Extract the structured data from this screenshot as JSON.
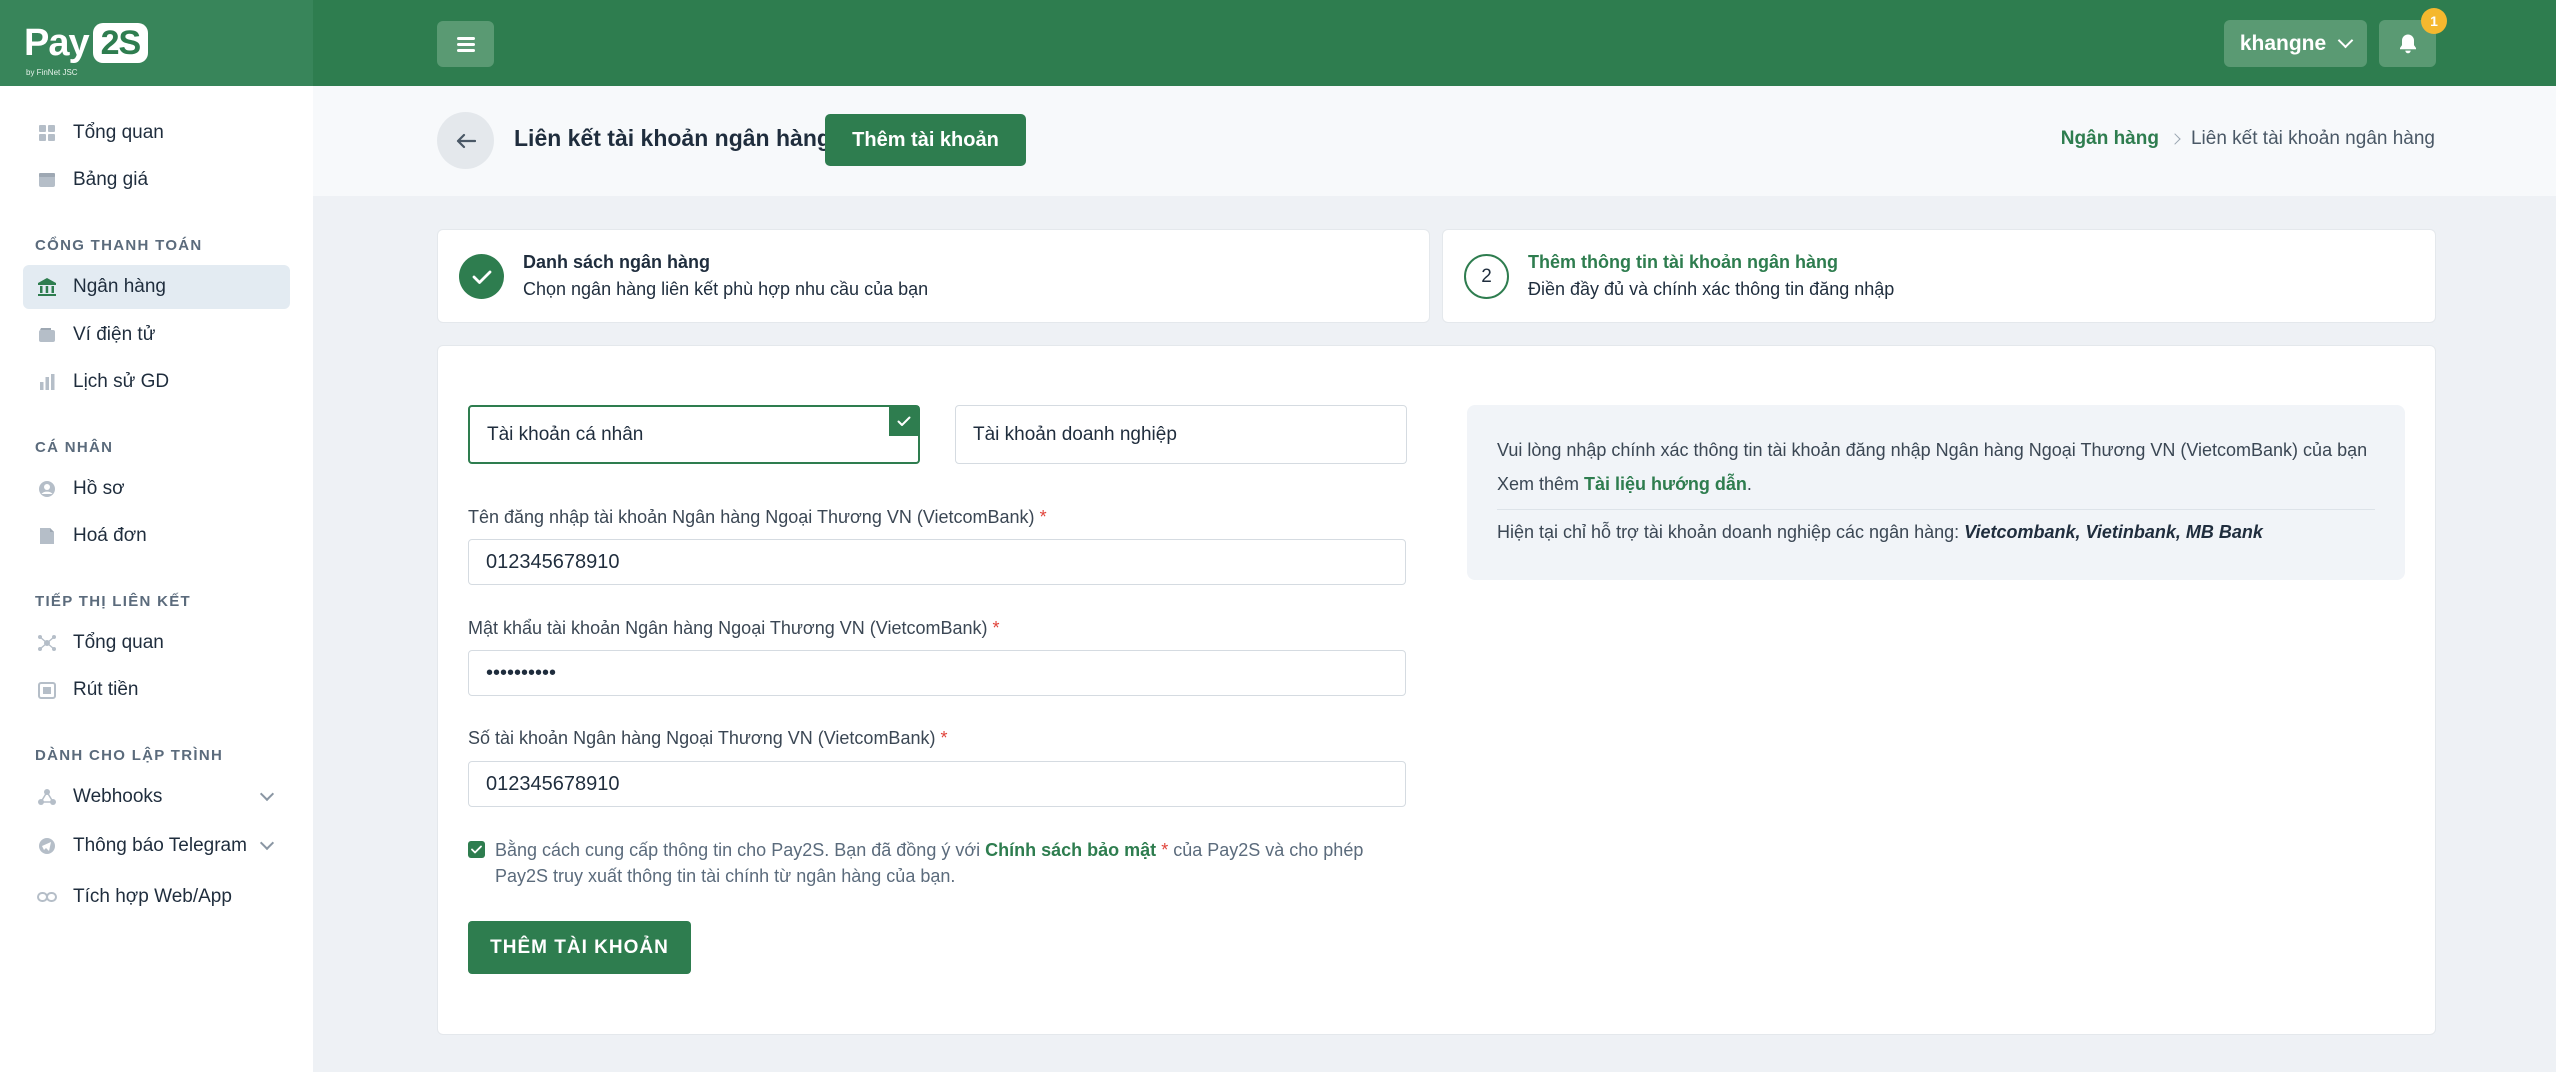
{
  "brand": {
    "logo_text": "Pay",
    "logo_suffix": "2S",
    "logo_byline": "by FinNet JSC"
  },
  "topbar": {
    "username": "khangne",
    "notification_count": "1"
  },
  "sidebar": {
    "top_items": [
      {
        "label": "Tổng quan",
        "icon": "grid-icon"
      },
      {
        "label": "Bảng giá",
        "icon": "price-tag-icon"
      }
    ],
    "sections": [
      {
        "title": "CỔNG THANH TOÁN",
        "items": [
          {
            "label": "Ngân hàng",
            "icon": "bank-icon",
            "active": true
          },
          {
            "label": "Ví điện tử",
            "icon": "wallet-icon"
          },
          {
            "label": "Lịch sử GD",
            "icon": "bar-chart-icon"
          }
        ]
      },
      {
        "title": "CÁ NHÂN",
        "items": [
          {
            "label": "Hồ sơ",
            "icon": "user-circle-icon"
          },
          {
            "label": "Hoá đơn",
            "icon": "invoice-icon"
          }
        ]
      },
      {
        "title": "TIẾP THỊ LIÊN KẾT",
        "items": [
          {
            "label": "Tổng quan",
            "icon": "network-icon"
          },
          {
            "label": "Rút tiền",
            "icon": "withdraw-icon"
          }
        ]
      },
      {
        "title": "DÀNH CHO LẬP TRÌNH",
        "items": [
          {
            "label": "Webhooks",
            "icon": "webhook-icon",
            "expandable": true
          },
          {
            "label": "Thông báo Telegram",
            "icon": "telegram-icon",
            "expandable": true
          },
          {
            "label": "Tích hợp Web/App",
            "icon": "link-icon"
          }
        ]
      }
    ]
  },
  "header": {
    "title": "Liên kết tài khoản ngân hàng",
    "add_button": "Thêm tài khoản",
    "breadcrumb": {
      "parent": "Ngân hàng",
      "current": "Liên kết tài khoản ngân hàng"
    }
  },
  "steps": [
    {
      "number": "1",
      "title": "Danh sách ngân hàng",
      "subtitle": "Chọn ngân hàng liên kết phù hợp nhu cầu của bạn",
      "status": "done"
    },
    {
      "number": "2",
      "title": "Thêm thông tin tài khoản ngân hàng",
      "subtitle": "Điền đầy đủ và chính xác thông tin đăng nhập",
      "status": "current"
    }
  ],
  "form": {
    "account_types": [
      {
        "label": "Tài khoản cá nhân",
        "selected": true
      },
      {
        "label": "Tài khoản doanh nghiệp",
        "selected": false
      }
    ],
    "fields": [
      {
        "label": "Tên đăng nhập tài khoản Ngân hàng Ngoại Thương VN (VietcomBank)",
        "required_mark": "*",
        "value": "012345678910",
        "type": "text"
      },
      {
        "label": "Mật khẩu tài khoản Ngân hàng Ngoại Thương VN (VietcomBank)",
        "required_mark": "*",
        "value": "••••••••••",
        "type": "password"
      },
      {
        "label": "Số tài khoản Ngân hàng Ngoại Thương VN (VietcomBank)",
        "required_mark": "*",
        "value": "012345678910",
        "type": "text"
      }
    ],
    "agreement": {
      "checked": true,
      "text_before": "Bằng cách cung cấp thông tin cho Pay2S. Bạn đã đồng ý với ",
      "policy_link": "Chính sách bảo mật",
      "required_mark": "*",
      "text_after": " của Pay2S và cho phép Pay2S truy xuất thông tin tài chính từ ngân hàng của bạn."
    },
    "submit_label": "THÊM TÀI KHOẢN"
  },
  "info": {
    "line1": "Vui lòng nhập chính xác thông tin tài khoản đăng nhập Ngân hàng Ngoại Thương VN (VietcomBank) của bạn",
    "line2_prefix": "Xem thêm ",
    "doc_link": "Tài liệu hướng dẫn",
    "line2_suffix": ".",
    "line3_prefix": "Hiện tại chỉ hỗ trợ tài khoản doanh nghiệp các ngân hàng: ",
    "line3_banks": "Vietcombank, Vietinbank, MB Bank"
  },
  "colors": {
    "primary": "#2e7d4f",
    "topbar": "#2e7d4f",
    "badge": "#f5b82e",
    "required": "#e0433a"
  }
}
